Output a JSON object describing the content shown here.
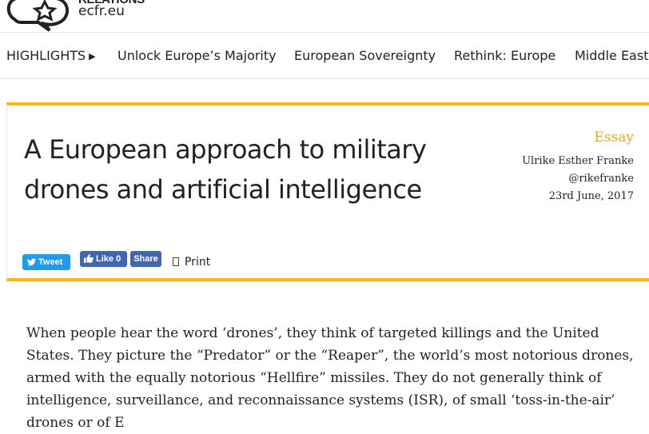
{
  "header": {
    "logo_relations": "RELATIONS",
    "logo_url": "ecfr.eu"
  },
  "nav": {
    "highlights_label": "HIGHLIGHTS",
    "items": [
      {
        "label": "Unlock Europe’s Majority"
      },
      {
        "label": "European Sovereignty"
      },
      {
        "label": "Rethink: Europe"
      },
      {
        "label": "Middle East"
      }
    ]
  },
  "article": {
    "title": "A European approach to military drones and artificial intelligence",
    "type": "Essay",
    "author": "Ulrike Esther Franke",
    "handle": "@rikefranke",
    "date": "23rd June, 2017"
  },
  "share": {
    "tweet_label": "Tweet",
    "like_label": "Like 0",
    "share_label": "Share",
    "print_label": "Print"
  },
  "body": {
    "paragraph": "When people hear the word ‘drones’, they think of targeted killings and the United States. They picture the “Predator” or the “Reaper”, the world’s most notorious drones, armed with the equally notorious “Hellfire” missiles. They do not generally think of intelligence, surveillance, and reconnaissance systems (ISR), of small ‘toss-in-the-air’ drones or of E"
  },
  "colors": {
    "accent_yellow": "#f6b821",
    "essay_label": "#e0a82a",
    "twitter_blue": "#1d9bf0",
    "facebook_blue": "#4267b2"
  }
}
